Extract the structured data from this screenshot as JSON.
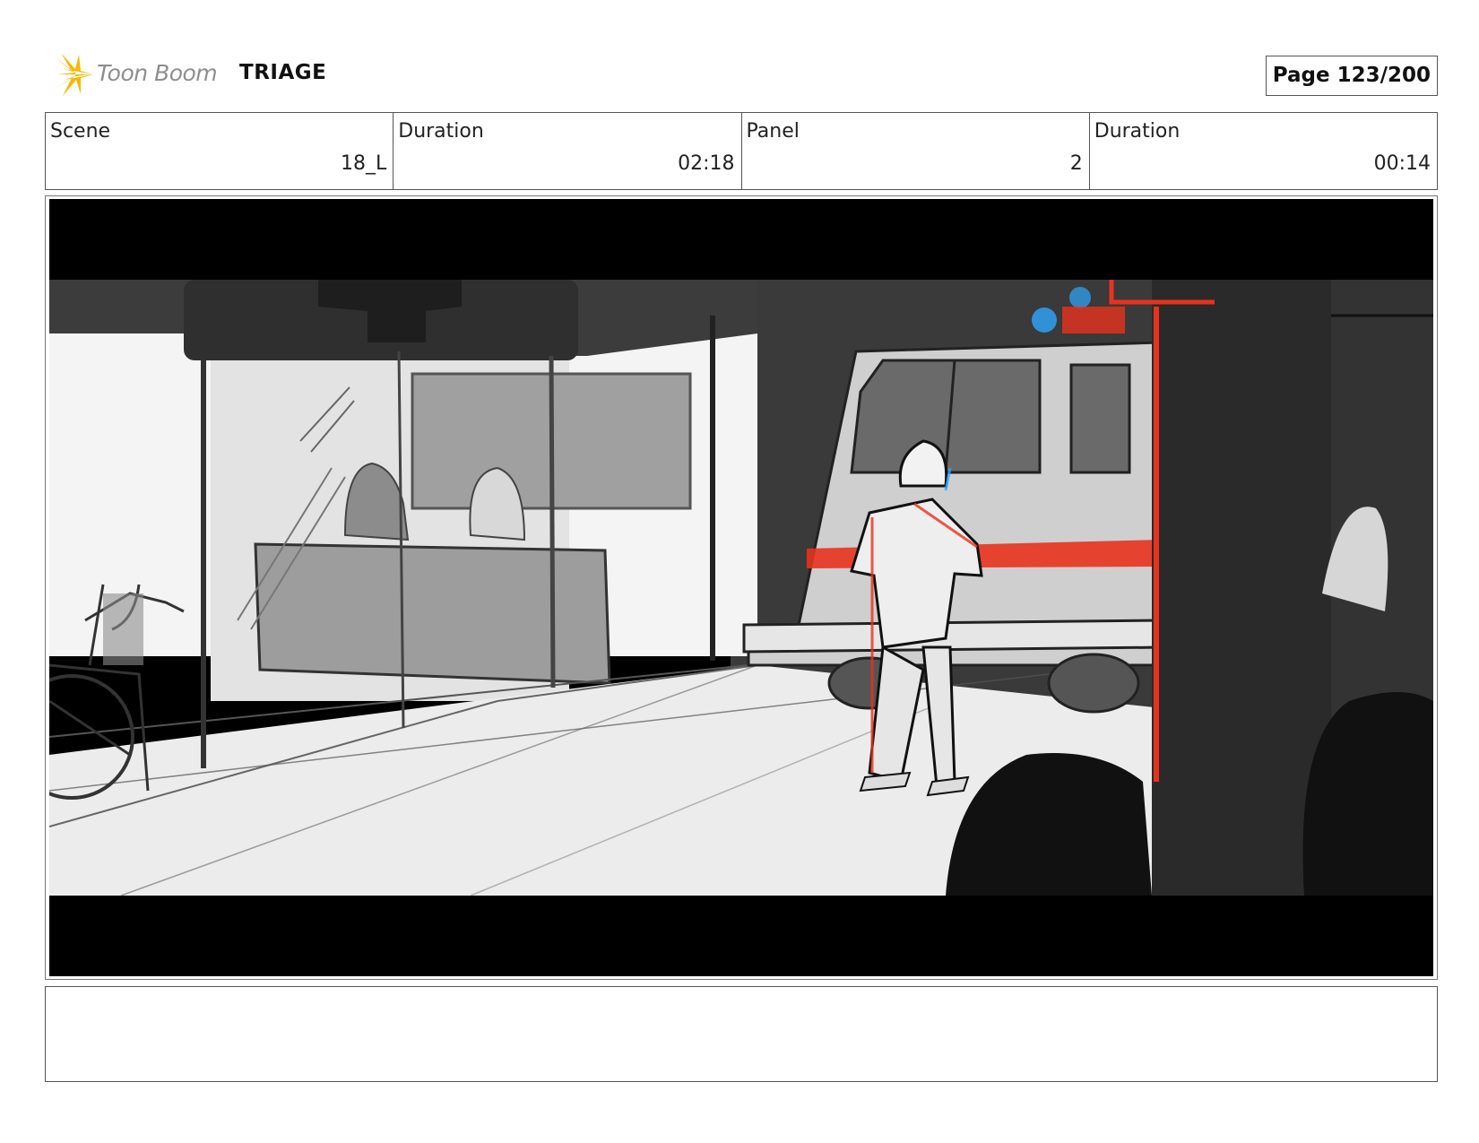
{
  "header": {
    "brand": "Toon Boom",
    "project_title": "TRIAGE",
    "page_label": "Page 123/200",
    "logo_icon": "starburst-logo-icon",
    "logo_color": "#f5b800"
  },
  "info": {
    "scene_label": "Scene",
    "scene_value": "18_L",
    "scene_duration_label": "Duration",
    "scene_duration_value": "02:18",
    "panel_label": "Panel",
    "panel_value": "2",
    "panel_duration_label": "Duration",
    "panel_duration_value": "00:14"
  },
  "panel": {
    "accent_red": "#e8321e",
    "accent_blue": "#2ea8ff"
  },
  "notes": {
    "text": ""
  }
}
